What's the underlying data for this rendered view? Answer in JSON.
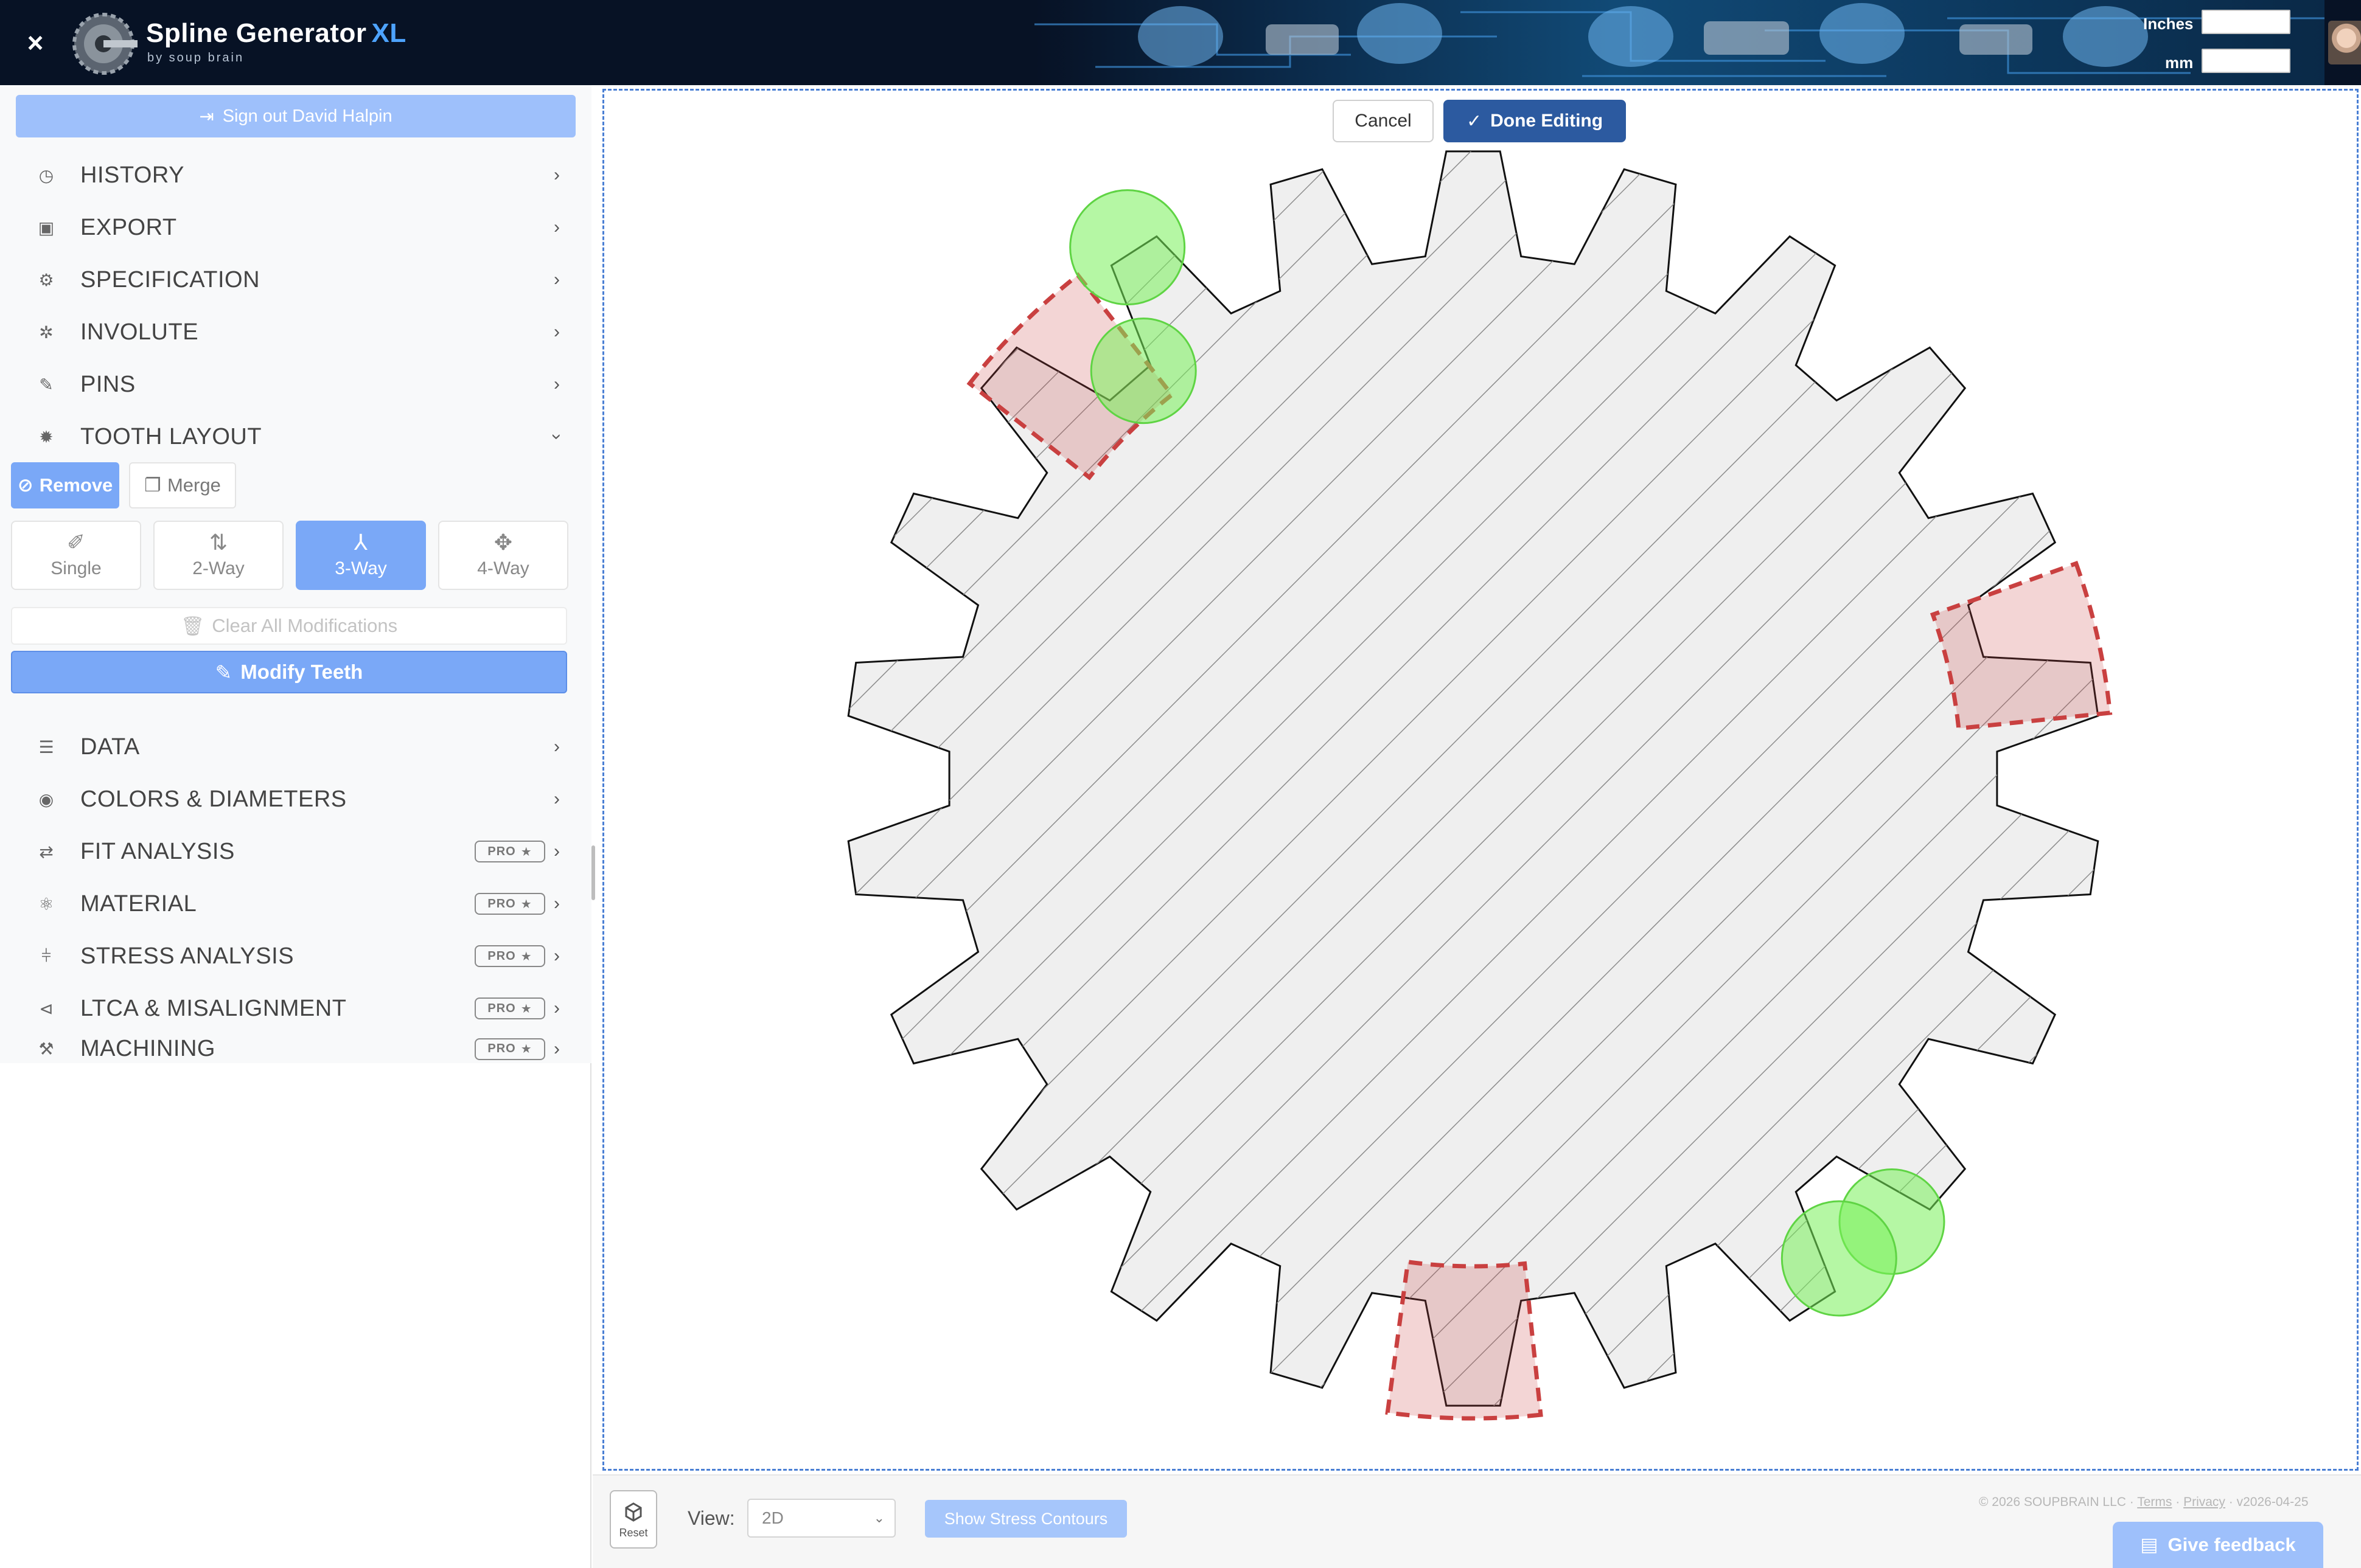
{
  "header": {
    "title": "Spline Generator",
    "title_suffix": "XL",
    "subtitle": "by soup brain",
    "close_label": "×",
    "inches_label": "Inches",
    "mm_label": "mm",
    "inches_value": "",
    "mm_value": ""
  },
  "sidebar": {
    "signout_label": "Sign out David Halpin",
    "menu": [
      {
        "label": "HISTORY",
        "icon": "history-icon"
      },
      {
        "label": "EXPORT",
        "icon": "save-icon"
      },
      {
        "label": "SPECIFICATION",
        "icon": "gears-icon"
      },
      {
        "label": "INVOLUTE",
        "icon": "gear-icon"
      },
      {
        "label": "PINS",
        "icon": "pin-icon"
      },
      {
        "label": "TOOTH LAYOUT",
        "icon": "cog-icon"
      }
    ],
    "tooth_layout": {
      "remove_label": "Remove",
      "merge_label": "Merge",
      "ways": [
        "Single",
        "2-Way",
        "3-Way",
        "4-Way"
      ],
      "active_way": "3-Way",
      "clear_label": "Clear All Modifications",
      "modify_label": "Modify Teeth"
    },
    "menu2": [
      {
        "label": "DATA",
        "icon": "database-icon",
        "pro": false
      },
      {
        "label": "COLORS & DIAMETERS",
        "icon": "palette-icon",
        "pro": false
      },
      {
        "label": "FIT ANALYSIS",
        "icon": "swap-icon",
        "pro": true
      },
      {
        "label": "MATERIAL",
        "icon": "atom-icon",
        "pro": true
      },
      {
        "label": "STRESS ANALYSIS",
        "icon": "dumbbell-icon",
        "pro": true
      },
      {
        "label": "LTCA & MISALIGNMENT",
        "icon": "branch-icon",
        "pro": true
      },
      {
        "label": "MACHINING",
        "icon": "hammer-icon",
        "pro": true
      }
    ],
    "pro_label": "PRO"
  },
  "canvas": {
    "cancel_label": "Cancel",
    "done_label": "Done Editing",
    "gear": {
      "teeth": 22,
      "removed_teeth_markers": 3,
      "merged_tooth_markers": 2,
      "colors": {
        "fill": "#efefef",
        "stroke": "#111111",
        "remove": "#c94040",
        "merge": "#78f05a"
      }
    }
  },
  "bottom": {
    "reset_label": "Reset",
    "view_label": "View:",
    "view_value": "2D",
    "stress_label": "Show Stress Contours",
    "footer_copyright": "© 2026 SOUPBRAIN LLC ·",
    "footer_terms": "Terms",
    "footer_sep": "·",
    "footer_privacy": "Privacy",
    "footer_version": "· v2026-04-25",
    "feedback_label": "Give feedback"
  }
}
